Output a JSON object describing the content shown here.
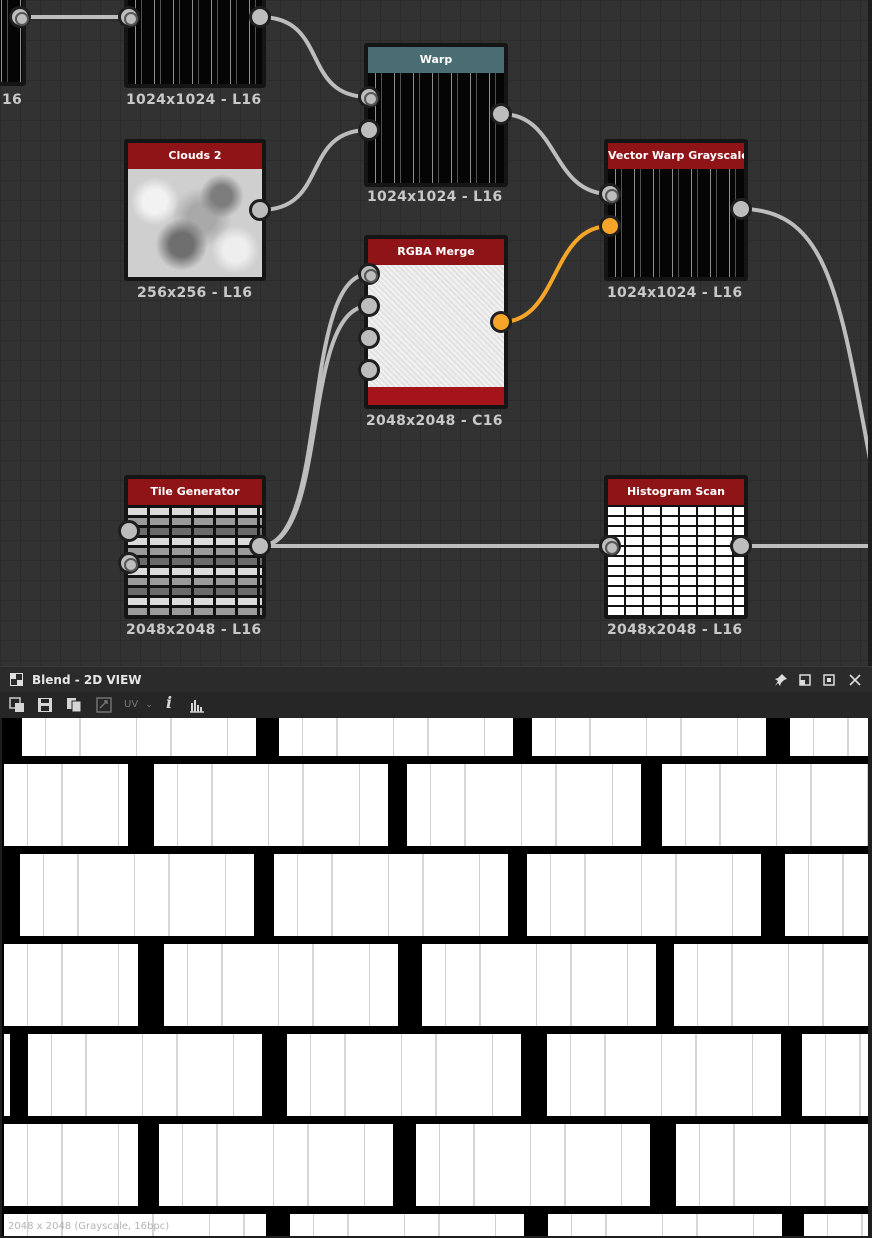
{
  "graph": {
    "nodes": {
      "top_left_partial": {
        "label": "16"
      },
      "top_mid": {
        "label": "1024x1024 - L16"
      },
      "warp": {
        "title": "Warp",
        "label": "1024x1024 - L16"
      },
      "clouds2": {
        "title": "Clouds 2",
        "label": "256x256 - L16"
      },
      "rgba_merge": {
        "title": "RGBA Merge",
        "label": "2048x2048 - C16"
      },
      "vector_warp": {
        "title": "Vector Warp Grayscale",
        "label": "1024x1024 - L16"
      },
      "tile_generator": {
        "title": "Tile Generator",
        "label": "2048x2048 - L16"
      },
      "histogram_scan": {
        "title": "Histogram Scan",
        "label": "2048x2048 - L16"
      }
    },
    "colors": {
      "header_red": "#8e1418",
      "header_teal": "#4a6d73",
      "wire": "#bdbdbd",
      "wire_active": "#f5a628"
    }
  },
  "panel": {
    "title": "Blend - 2D VIEW",
    "icons": {
      "title": "view-panel-icon",
      "pin": "pin-icon",
      "float": "float-window-icon",
      "maximize": "maximize-icon",
      "close": "close-icon"
    },
    "toolbar": {
      "uv_label": "UV",
      "icons": [
        "copy-view-icon",
        "save-icon",
        "duplicate-icon",
        "tiling-icon",
        "uv-dropdown",
        "info-icon",
        "histogram-icon"
      ]
    },
    "status": "2048 x 2048 (Grayscale, 16bpc)"
  }
}
